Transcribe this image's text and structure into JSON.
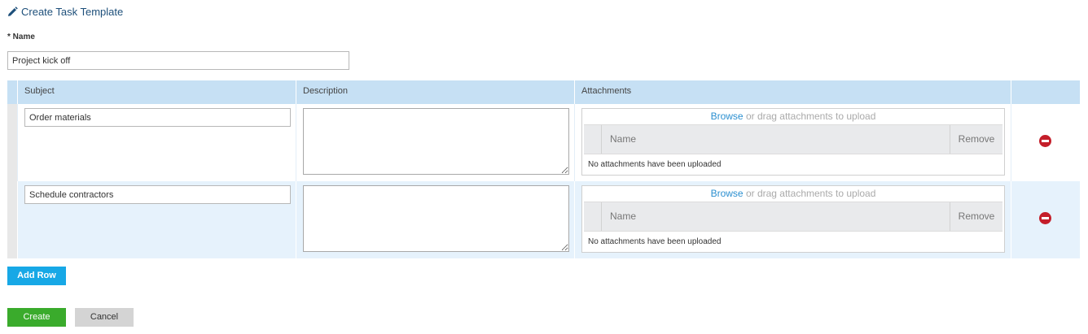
{
  "page": {
    "title": "Create Task Template",
    "title_icon": "pencil-icon"
  },
  "form": {
    "name_label": "* Name",
    "name_value": "Project kick off"
  },
  "grid": {
    "columns": [
      "Subject",
      "Description",
      "Attachments"
    ],
    "rows": [
      {
        "subject": "Order materials",
        "description": "",
        "attachments": {
          "browse_label": "Browse",
          "drop_hint": " or drag attachments to upload",
          "name_header": "Name",
          "remove_header": "Remove",
          "empty_text": "No attachments have been uploaded"
        }
      },
      {
        "subject": "Schedule contractors",
        "description": "",
        "attachments": {
          "browse_label": "Browse",
          "drop_hint": " or drag attachments to upload",
          "name_header": "Name",
          "remove_header": "Remove",
          "empty_text": "No attachments have been uploaded"
        }
      }
    ]
  },
  "actions": {
    "add_row": "Add Row",
    "create": "Create",
    "cancel": "Cancel"
  },
  "colors": {
    "title": "#1d4f7a",
    "header_bg": "#c6e0f4",
    "alt_row_bg": "#e6f2fc",
    "add_button": "#17a8e6",
    "create_button": "#3aab2c",
    "cancel_button": "#d4d4d4",
    "remove_icon": "#c41e2a",
    "browse_link": "#2b8fd0"
  }
}
